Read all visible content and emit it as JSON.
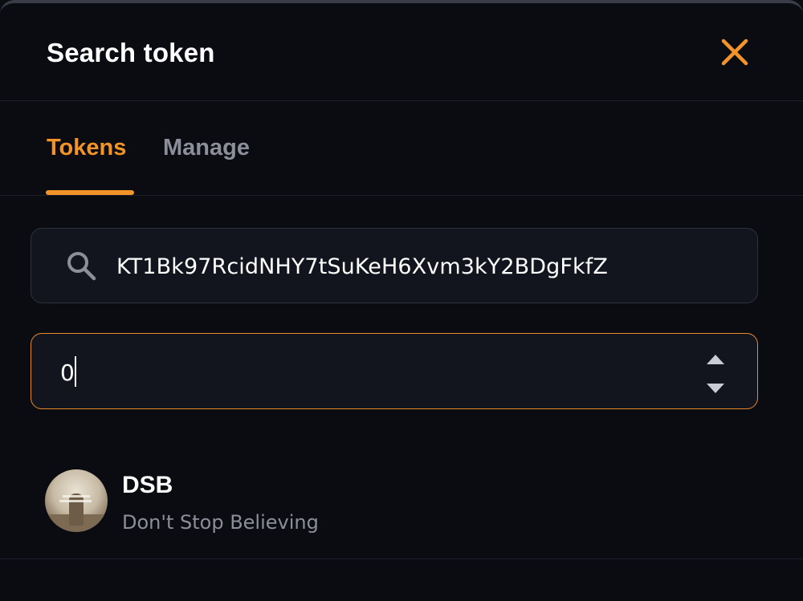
{
  "modal": {
    "title": "Search token",
    "close_icon": "close-icon"
  },
  "tabs": [
    {
      "label": "Tokens",
      "active": true
    },
    {
      "label": "Manage",
      "active": false
    }
  ],
  "search": {
    "icon": "search-icon",
    "value": "KT1Bk97RcidNHY7tSuKeH6Xvm3kY2BDgFkfZ"
  },
  "token_id_field": {
    "value": "0",
    "stepper_up_icon": "caret-up-icon",
    "stepper_down_icon": "caret-down-icon"
  },
  "results": [
    {
      "symbol": "DSB",
      "name": "Don't Stop Believing"
    }
  ],
  "colors": {
    "accent": "#f29427",
    "background": "#0a0c12",
    "field_background": "#12151d",
    "muted_text": "#8c8f99"
  }
}
